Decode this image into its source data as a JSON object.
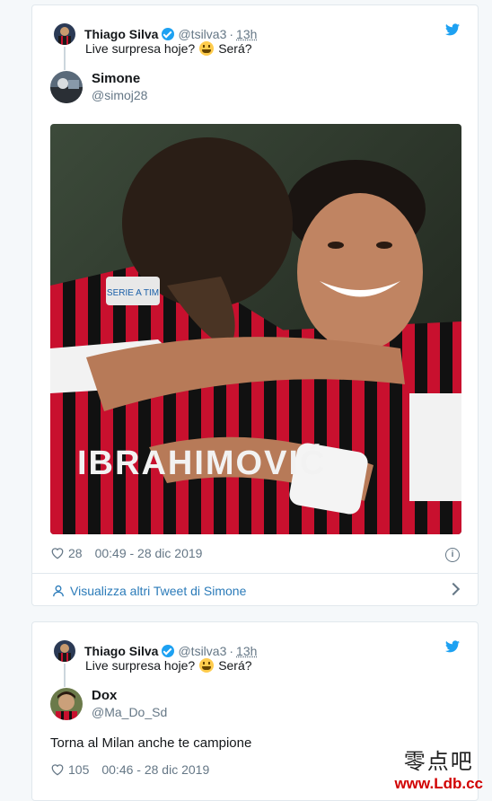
{
  "tweets": [
    {
      "context": {
        "name": "Thiago Silva",
        "handle": "@tsilva3",
        "separator": "·",
        "time": "13h",
        "text_before": "Live surpresa hoje?",
        "text_after": "Será?"
      },
      "author": {
        "name": "Simone",
        "handle": "@simoj28"
      },
      "likes": "28",
      "timestamp": "00:49 - 28 dic 2019",
      "more_link": "Visualizza altri Tweet di Simone"
    },
    {
      "context": {
        "name": "Thiago Silva",
        "handle": "@tsilva3",
        "separator": "·",
        "time": "13h",
        "text_before": "Live surpresa hoje?",
        "text_after": "Será?"
      },
      "author": {
        "name": "Dox",
        "handle": "@Ma_Do_Sd"
      },
      "body": "Torna al Milan anche te campione",
      "likes": "105",
      "timestamp": "00:46 - 28 dic 2019"
    }
  ],
  "photo": {
    "jersey_text": "IBRAHIMOVIĆ",
    "badge_text": "SERIE A TIM",
    "colors": {
      "red": "#c8102e",
      "black": "#111111",
      "white": "#f2f2f2"
    }
  },
  "watermark": {
    "chinese": "零点吧",
    "url": "www.Ldb.cc"
  },
  "colors": {
    "accent": "#1da1f2",
    "link": "#2b7bb9",
    "muted": "#657786",
    "border": "#e1e8ed"
  }
}
